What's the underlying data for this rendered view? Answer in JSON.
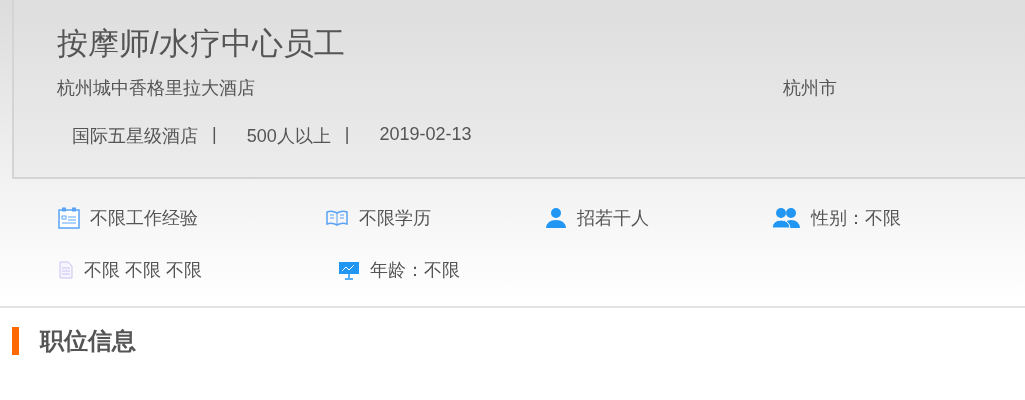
{
  "job": {
    "title": "按摩师/水疗中心员工",
    "company": "杭州城中香格里拉大酒店",
    "city": "杭州市",
    "meta": [
      {
        "text": "国际五星级酒店",
        "separator": "|"
      },
      {
        "text": "500人以上",
        "separator": "|"
      },
      {
        "text": "2019-02-13"
      }
    ]
  },
  "requirements": [
    {
      "kind": "experience",
      "text": "不限工作经验"
    },
    {
      "kind": "education",
      "text": "不限学历"
    },
    {
      "kind": "headcount",
      "text": "招若干人"
    },
    {
      "kind": "gender",
      "text": "性别：不限"
    },
    {
      "kind": "other",
      "text": "不限 不限 不限"
    },
    {
      "kind": "age",
      "text": "年龄：不限"
    }
  ],
  "section": {
    "title": "职位信息"
  }
}
